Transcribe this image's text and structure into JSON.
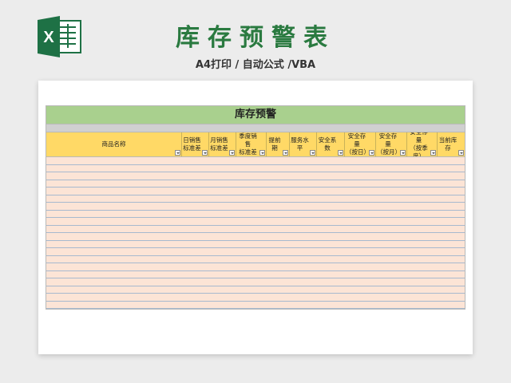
{
  "logo": {
    "letter": "X",
    "icon": "excel-icon",
    "color": "#1e7145"
  },
  "title": "库存预警表",
  "subtitle": "A4打印 / 自动公式 /VBA",
  "sheet": {
    "banner": "库存预警",
    "columns": [
      "商品名称",
      "日销售\n标准差",
      "月销售\n标准差",
      "季度销售\n标准差",
      "提前期",
      "服务水平",
      "安全系数",
      "安全存量\n（按日）",
      "安全存量\n（按月）",
      "安全存量\n（按季\n度）",
      "当前库存"
    ],
    "row_count": 20
  },
  "colors": {
    "title_green": "#2a7a40",
    "banner_green": "#a9d08e",
    "header_yellow": "#ffd966",
    "row_peach": "#fce4d6"
  }
}
